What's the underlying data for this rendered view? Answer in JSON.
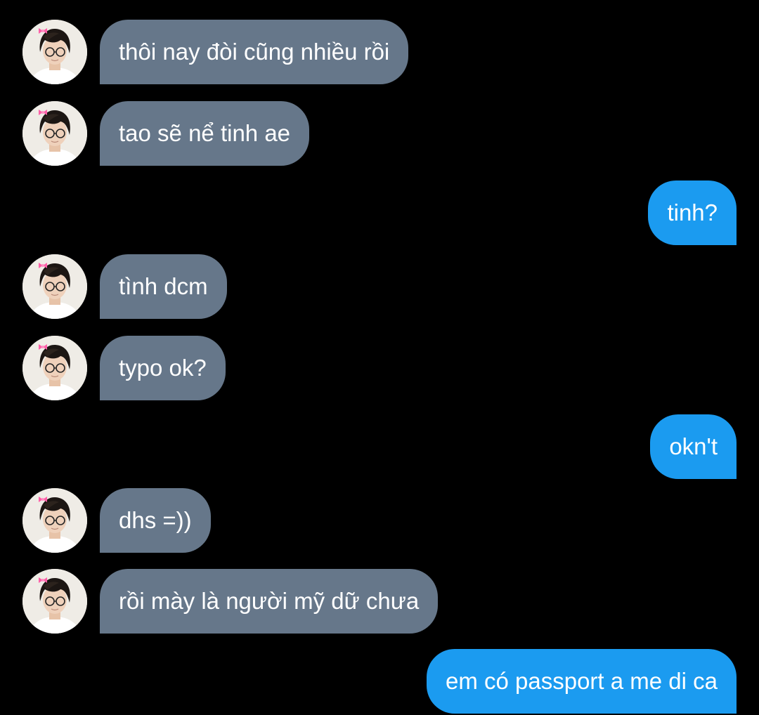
{
  "conversation": {
    "colors": {
      "background": "#000000",
      "received_bubble": "#66778a",
      "sent_bubble": "#1b9bf0",
      "text": "#ffffff"
    },
    "messages": [
      {
        "direction": "received",
        "text": "thôi nay đòi cũng nhiều rồi",
        "avatar": "profile-photo-with-pink-bow"
      },
      {
        "direction": "received",
        "text": "tao sẽ nể tinh ae",
        "avatar": "profile-photo-with-pink-bow"
      },
      {
        "direction": "sent",
        "text": "tinh?"
      },
      {
        "direction": "received",
        "text": "tình dcm",
        "avatar": "profile-photo-with-pink-bow"
      },
      {
        "direction": "received",
        "text": "typo ok?",
        "avatar": "profile-photo-with-pink-bow"
      },
      {
        "direction": "sent",
        "text": "okn't"
      },
      {
        "direction": "received",
        "text": "dhs =))",
        "avatar": "profile-photo-with-pink-bow"
      },
      {
        "direction": "received",
        "text": "rồi mày là người mỹ dữ chưa",
        "avatar": "profile-photo-with-pink-bow"
      },
      {
        "direction": "sent",
        "text": "em có passport a me di ca"
      }
    ]
  }
}
